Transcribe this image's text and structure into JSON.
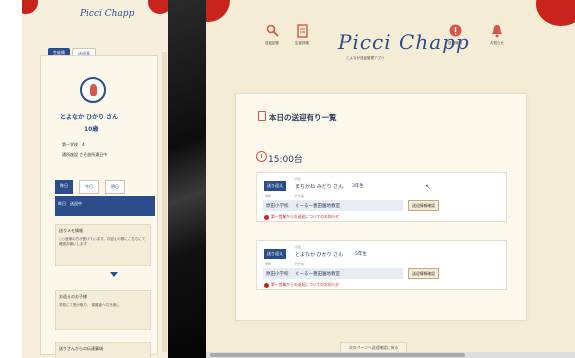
{
  "left": {
    "logo": "Picci Chapp",
    "tabs": [
      "生徒情",
      "送迎表"
    ],
    "name": "とよなか ひかり さん",
    "age": "10歳",
    "info": [
      "第一学校　4",
      "通所施設 さそ曲所通日中"
    ],
    "day_tabs": [
      "昨日",
      "今日",
      "明日"
    ],
    "band": "昨日　送迎中",
    "box1": {
      "title": "送りメモ情報",
      "text": "○○医療の方が受けています。お迎えの際にこちらにて確認お願いします"
    },
    "box2": {
      "title": "お迎えのお子様",
      "text": "学校にて受け取り、 保護者へ引き渡し"
    },
    "box3": {
      "title": "送りさんからの伝達事項"
    }
  },
  "main": {
    "logo": "Picci Chapp",
    "logo_sub": "とよなか送迎管理アプリ",
    "nav": [
      {
        "label": "送迎記録",
        "icon": "search-icon"
      },
      {
        "label": "生徒詳細",
        "icon": "document-icon"
      },
      {
        "label": "送迎情報",
        "icon": "alert-icon"
      },
      {
        "label": "お知らせ",
        "icon": "bell-icon"
      }
    ],
    "panel_title": "本日の送迎有り一覧",
    "time_slot": "15:00台",
    "students": [
      {
        "tag": "送り迎え",
        "name_small": "氏名",
        "name": "まちかね みどり さん",
        "grade": "3年生",
        "school_small": "学校",
        "dest_small": "行き先",
        "school": "原田小学校",
        "dest": "ぐーるー豊田園地教室",
        "button": "送迎情報確認",
        "warning": "第一営業からの送迎についてのお知らせ"
      },
      {
        "tag": "送り迎え",
        "name_small": "氏名",
        "name": "とよなか ひかり さん",
        "grade": "5年生",
        "school_small": "学校",
        "dest_small": "行き先",
        "school": "原田小学校",
        "dest": "ぐーるー豊田園地教室",
        "button": "送迎情報確認",
        "warning": "第一営業からの送迎についてのお知らせ"
      }
    ],
    "footer_button": "次のページへ送迎確認に戻る"
  }
}
